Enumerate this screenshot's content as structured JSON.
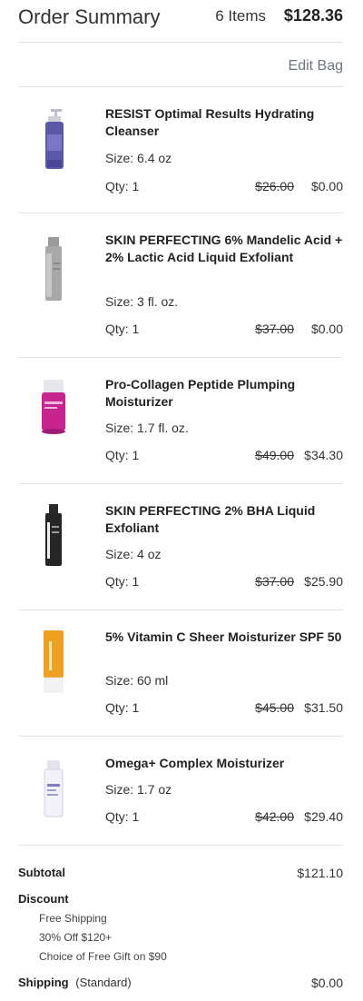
{
  "header": {
    "title": "Order Summary",
    "item_count": "6 Items",
    "total": "$128.36",
    "edit_label": "Edit Bag"
  },
  "products": [
    {
      "name": "RESIST Optimal Results Hydrating Cleanser",
      "size": "Size: 6.4 oz",
      "qty": "Qty: 1",
      "original_price": "$26.00",
      "price": "$0.00",
      "image": "purple-pump-bottle"
    },
    {
      "name": "SKIN PERFECTING 6% Mandelic Acid + 2% Lactic Acid Liquid Exfoliant",
      "size": "Size: 3 fl. oz.",
      "qty": "Qty: 1",
      "original_price": "$37.00",
      "price": "$0.00",
      "image": "gray-bottle"
    },
    {
      "name": "Pro-Collagen Peptide Plumping Moisturizer",
      "size": "Size: 1.7 fl. oz.",
      "qty": "Qty: 1",
      "original_price": "$49.00",
      "price": "$34.30",
      "image": "magenta-jar"
    },
    {
      "name": "SKIN PERFECTING 2% BHA Liquid Exfoliant",
      "size": "Size: 4 oz",
      "qty": "Qty: 1",
      "original_price": "$37.00",
      "price": "$25.90",
      "image": "black-bottle"
    },
    {
      "name": "5% Vitamin C Sheer Moisturizer SPF 50",
      "size": "Size: 60 ml",
      "qty": "Qty: 1",
      "original_price": "$45.00",
      "price": "$31.50",
      "image": "orange-tube"
    },
    {
      "name": "Omega+ Complex Moisturizer",
      "size": "Size: 1.7 oz",
      "qty": "Qty: 1",
      "original_price": "$42.00",
      "price": "$29.40",
      "image": "white-pump-bottle"
    }
  ],
  "totals": {
    "subtotal_label": "Subtotal",
    "subtotal_value": "$121.10",
    "discount_label": "Discount",
    "discounts": [
      "Free Shipping",
      "30% Off $120+",
      "Choice of Free Gift on $90"
    ],
    "shipping_label": "Shipping",
    "shipping_method": "(Standard)",
    "shipping_value": "$0.00"
  }
}
